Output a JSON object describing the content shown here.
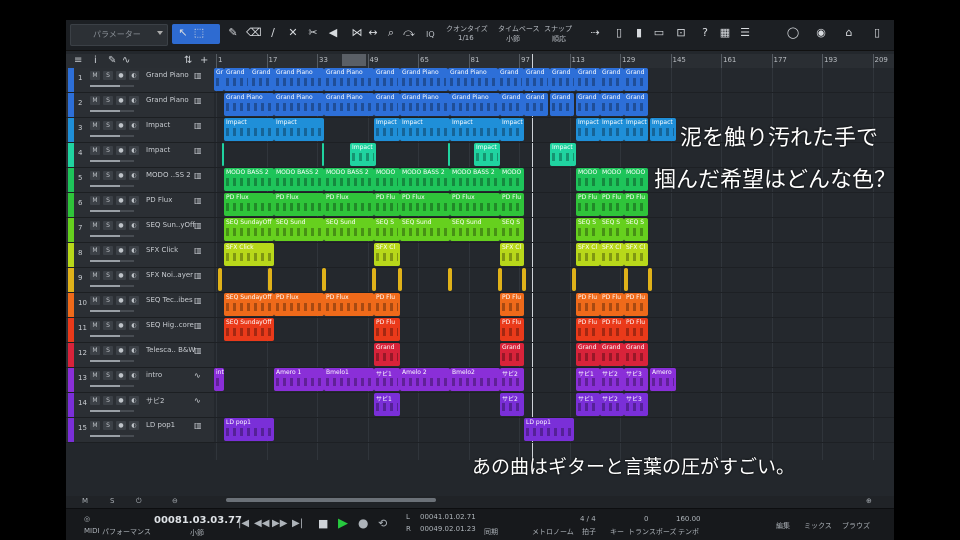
{
  "toolbar": {
    "parameter_label": "パラメーター",
    "quantize_label": "クオンタイズ",
    "quantize_value": "1/16",
    "timebase_label": "タイムベース",
    "timebase_value": "小節",
    "snap_label": "スナップ",
    "snap_value": "順応",
    "iq_label": "IQ"
  },
  "ruler": {
    "marks": [
      "1",
      "17",
      "33",
      "49",
      "65",
      "81",
      "97",
      "113",
      "129",
      "145",
      "161",
      "177",
      "193",
      "209"
    ]
  },
  "tracks": [
    {
      "num": "1",
      "name": "Grand Piano",
      "color": "#2d6fd8",
      "type": "instrument"
    },
    {
      "num": "2",
      "name": "Grand Piano",
      "color": "#2d6fd8",
      "type": "instrument"
    },
    {
      "num": "3",
      "name": "Impact",
      "color": "#1f8fd8",
      "type": "instrument"
    },
    {
      "num": "4",
      "name": "Impact",
      "color": "#20d3a0",
      "type": "instrument"
    },
    {
      "num": "5",
      "name": "MODO ..SS 2",
      "color": "#1ec45a",
      "type": "instrument"
    },
    {
      "num": "6",
      "name": "PD Flux",
      "color": "#2fc43a",
      "type": "instrument"
    },
    {
      "num": "7",
      "name": "SEQ Sun..yOff",
      "color": "#66d01e",
      "type": "instrument"
    },
    {
      "num": "8",
      "name": "SFX Click",
      "color": "#b8d81a",
      "type": "instrument"
    },
    {
      "num": "9",
      "name": "SFX Noi..ayer",
      "color": "#e0b21a",
      "type": "instrument"
    },
    {
      "num": "10",
      "name": "SEQ Tec..ibes",
      "color": "#ef6a1a",
      "type": "instrument"
    },
    {
      "num": "11",
      "name": "SEQ Hig..core",
      "color": "#ea3a1a",
      "type": "instrument"
    },
    {
      "num": "12",
      "name": "Telesca.. B&W",
      "color": "#d8233a",
      "type": "instrument"
    },
    {
      "num": "13",
      "name": "intro",
      "color": "#8a2fd8",
      "type": "audio"
    },
    {
      "num": "14",
      "name": "サビ2",
      "color": "#7a2fd8",
      "type": "audio"
    },
    {
      "num": "15",
      "name": "LD pop1",
      "color": "#7a2fd8",
      "type": "instrument"
    }
  ],
  "clips": [
    {
      "row": 0,
      "label": "Gr"
    },
    {
      "row": 0,
      "label": "Grand"
    },
    {
      "row": 0,
      "label": "Grand"
    },
    {
      "row": 0,
      "label": "Grand Piano"
    },
    {
      "row": 0,
      "label": "Grand Piano"
    },
    {
      "row": 0,
      "label": "Grand"
    },
    {
      "row": 0,
      "label": "Grand Piano"
    },
    {
      "row": 0,
      "label": "Grand Piano"
    },
    {
      "row": 0,
      "label": "Grand"
    },
    {
      "row": 0,
      "label": "Grand"
    },
    {
      "row": 0,
      "label": "Grand"
    },
    {
      "row": 0,
      "label": "Grand"
    },
    {
      "row": 0,
      "label": "Grand"
    },
    {
      "row": 0,
      "label": "Grand"
    },
    {
      "row": 1,
      "label": "Grand Piano"
    },
    {
      "row": 1,
      "label": "Grand Piano"
    },
    {
      "row": 1,
      "label": "Grand Piano"
    },
    {
      "row": 1,
      "label": "Grand"
    },
    {
      "row": 1,
      "label": "Grand Piano"
    },
    {
      "row": 1,
      "label": "Grand Piano"
    },
    {
      "row": 1,
      "label": "Grand"
    },
    {
      "row": 1,
      "label": "Grand"
    },
    {
      "row": 1,
      "label": "Grand"
    },
    {
      "row": 1,
      "label": "Grand"
    },
    {
      "row": 1,
      "label": "Grand"
    },
    {
      "row": 1,
      "label": "Grand"
    },
    {
      "row": 2,
      "label": "Impact"
    },
    {
      "row": 2,
      "label": "Impact"
    },
    {
      "row": 2,
      "label": "Impact"
    },
    {
      "row": 2,
      "label": "Impact"
    },
    {
      "row": 2,
      "label": "Impact"
    },
    {
      "row": 2,
      "label": "Impact"
    },
    {
      "row": 2,
      "label": "Impact"
    },
    {
      "row": 2,
      "label": "Impact"
    },
    {
      "row": 2,
      "label": "Impact"
    },
    {
      "row": 2,
      "label": "Impact"
    },
    {
      "row": 3,
      "label": ""
    },
    {
      "row": 3,
      "label": ""
    },
    {
      "row": 3,
      "label": "Impact"
    },
    {
      "row": 3,
      "label": ""
    },
    {
      "row": 3,
      "label": "Impact"
    },
    {
      "row": 3,
      "label": "Impact"
    },
    {
      "row": 4,
      "label": "MODO BASS 2"
    },
    {
      "row": 4,
      "label": "MODO BASS 2"
    },
    {
      "row": 4,
      "label": "MODO BASS 2"
    },
    {
      "row": 4,
      "label": "MODO"
    },
    {
      "row": 4,
      "label": "MODO BASS 2"
    },
    {
      "row": 4,
      "label": "MODO BASS 2"
    },
    {
      "row": 4,
      "label": "MODO"
    },
    {
      "row": 4,
      "label": "MODO"
    },
    {
      "row": 4,
      "label": "MODO"
    },
    {
      "row": 4,
      "label": "MODO"
    },
    {
      "row": 5,
      "label": "PD Flux"
    },
    {
      "row": 5,
      "label": "PD Flux"
    },
    {
      "row": 5,
      "label": "PD Flux"
    },
    {
      "row": 5,
      "label": "PD Flu"
    },
    {
      "row": 5,
      "label": "PD Flux"
    },
    {
      "row": 5,
      "label": "PD Flux"
    },
    {
      "row": 5,
      "label": "PD Flu"
    },
    {
      "row": 5,
      "label": "PD Flu"
    },
    {
      "row": 5,
      "label": "PD Flu"
    },
    {
      "row": 5,
      "label": "PD Flu"
    },
    {
      "row": 6,
      "label": "SEQ SundayOff"
    },
    {
      "row": 6,
      "label": "SEQ Sund"
    },
    {
      "row": 6,
      "label": "SEQ Sund"
    },
    {
      "row": 6,
      "label": "SEQ S"
    },
    {
      "row": 6,
      "label": "SEQ Sund"
    },
    {
      "row": 6,
      "label": "SEQ Sund"
    },
    {
      "row": 6,
      "label": "SEQ S"
    },
    {
      "row": 6,
      "label": "SEQ S"
    },
    {
      "row": 6,
      "label": "SEQ S"
    },
    {
      "row": 6,
      "label": "SEQ S"
    },
    {
      "row": 7,
      "label": "SFX Click"
    },
    {
      "row": 7,
      "label": "SFX Cl"
    },
    {
      "row": 7,
      "label": "SFX Cl"
    },
    {
      "row": 7,
      "label": "SFX Cl"
    },
    {
      "row": 7,
      "label": "SFX Cl"
    },
    {
      "row": 7,
      "label": "SFX Cl"
    },
    {
      "row": 8,
      "label": ""
    },
    {
      "row": 8,
      "label": ""
    },
    {
      "row": 8,
      "label": ""
    },
    {
      "row": 8,
      "label": ""
    },
    {
      "row": 8,
      "label": ""
    },
    {
      "row": 8,
      "label": ""
    },
    {
      "row": 8,
      "label": ""
    },
    {
      "row": 8,
      "label": ""
    },
    {
      "row": 8,
      "label": ""
    },
    {
      "row": 8,
      "label": ""
    },
    {
      "row": 8,
      "label": ""
    },
    {
      "row": 9,
      "label": "SEQ SundayOff"
    },
    {
      "row": 9,
      "label": "PD Flux"
    },
    {
      "row": 9,
      "label": "PD Flux"
    },
    {
      "row": 9,
      "label": "PD Flu"
    },
    {
      "row": 9,
      "label": "PD Flu"
    },
    {
      "row": 9,
      "label": "PD Flu"
    },
    {
      "row": 9,
      "label": "PD Flu"
    },
    {
      "row": 9,
      "label": "PD Flu"
    },
    {
      "row": 10,
      "label": "SEQ SundayOff"
    },
    {
      "row": 10,
      "label": "PD Flu"
    },
    {
      "row": 10,
      "label": "PD Flu"
    },
    {
      "row": 10,
      "label": "PD Flu"
    },
    {
      "row": 10,
      "label": "PD Flu"
    },
    {
      "row": 10,
      "label": "PD Flu"
    },
    {
      "row": 11,
      "label": "Grand"
    },
    {
      "row": 11,
      "label": "Grand"
    },
    {
      "row": 11,
      "label": "Grand"
    },
    {
      "row": 11,
      "label": "Grand"
    },
    {
      "row": 11,
      "label": "Grand"
    },
    {
      "row": 12,
      "label": "int"
    },
    {
      "row": 12,
      "label": "Amero 1"
    },
    {
      "row": 12,
      "label": "Bmelo1"
    },
    {
      "row": 12,
      "label": "サビ1"
    },
    {
      "row": 12,
      "label": "Amelo 2"
    },
    {
      "row": 12,
      "label": "Bmelo2"
    },
    {
      "row": 12,
      "label": "サビ2"
    },
    {
      "row": 12,
      "label": "サビ1"
    },
    {
      "row": 12,
      "label": "サビ2"
    },
    {
      "row": 12,
      "label": "サビ3"
    },
    {
      "row": 12,
      "label": "Amero"
    },
    {
      "row": 13,
      "label": "サビ1"
    },
    {
      "row": 13,
      "label": "サビ2"
    },
    {
      "row": 13,
      "label": "サビ1"
    },
    {
      "row": 13,
      "label": "サビ2"
    },
    {
      "row": 13,
      "label": "サビ3"
    },
    {
      "row": 14,
      "label": "LD pop1"
    },
    {
      "row": 14,
      "label": "LD pop1"
    }
  ],
  "bottom": {
    "m_label": "M",
    "s_label": "S",
    "midi_label": "MIDI",
    "performance_label": "パフォーマンス",
    "position": "00081.03.03.77",
    "position_unit": "小節",
    "loop_l": "00041.01.02.71",
    "loop_r": "00049.02.01.23",
    "sync_label": "同期",
    "metronome_label": "メトロノーム",
    "time_sig": "4 / 4",
    "time_sig_label": "拍子",
    "key_label": "キー",
    "transpose_value": "0",
    "transpose_label": "トランスポーズ",
    "tempo_value": "160.00",
    "tempo_label": "テンポ",
    "edit_tab": "編集",
    "mix_tab": "ミックス",
    "browse_tab": "ブラウズ"
  },
  "captions": {
    "line1": "泥を触り汚れた手で",
    "line2": "掴んだ希望はどんな色？",
    "line3": "あの曲はギターと言葉の圧がすごい。"
  }
}
